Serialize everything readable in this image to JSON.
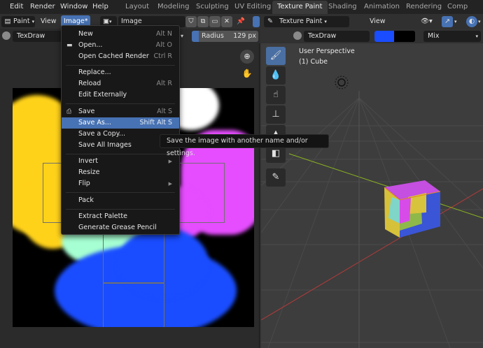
{
  "topbar": {
    "menus": [
      "Edit",
      "Render",
      "Window",
      "Help"
    ],
    "workspace_tabs": [
      "Layout",
      "Modeling",
      "Sculpting",
      "UV Editing",
      "Texture Paint",
      "Shading",
      "Animation",
      "Rendering",
      "Comp"
    ],
    "active_tab": "Texture Paint"
  },
  "image_editor": {
    "mode": "Paint",
    "view_menu": "View",
    "image_menu": "Image*",
    "image_name": "Image",
    "brush_name": "TexDraw",
    "radius_label": "Radius",
    "radius_value": "129 px"
  },
  "image_menu": {
    "items": [
      {
        "label": "New",
        "shortcut": "Alt N",
        "icon": ""
      },
      {
        "label": "Open...",
        "shortcut": "Alt O",
        "icon": "folder-icon"
      },
      {
        "label": "Open Cached Render",
        "shortcut": "Ctrl R",
        "icon": ""
      },
      {
        "label": "Replace...",
        "shortcut": "",
        "icon": ""
      },
      {
        "label": "Reload",
        "shortcut": "Alt R",
        "icon": ""
      },
      {
        "label": "Edit Externally",
        "shortcut": "",
        "icon": ""
      },
      {
        "label": "Save",
        "shortcut": "Alt S",
        "icon": "save-icon"
      },
      {
        "label": "Save As...",
        "shortcut": "Shift Alt S",
        "icon": ""
      },
      {
        "label": "Save a Copy...",
        "shortcut": "",
        "icon": ""
      },
      {
        "label": "Save All Images",
        "shortcut": "",
        "icon": ""
      },
      {
        "label": "Invert",
        "shortcut": "",
        "icon": "submenu"
      },
      {
        "label": "Resize",
        "shortcut": "",
        "icon": ""
      },
      {
        "label": "Flip",
        "shortcut": "",
        "icon": "submenu"
      },
      {
        "label": "Pack",
        "shortcut": "",
        "icon": ""
      },
      {
        "label": "Extract Palette",
        "shortcut": "",
        "icon": ""
      },
      {
        "label": "Generate Grease Pencil",
        "shortcut": "",
        "icon": ""
      }
    ],
    "highlighted": "Save As...",
    "tooltip": "Save the image with another name and/or settings."
  },
  "viewport": {
    "mode": "Texture Paint",
    "view_menu": "View",
    "brush_name": "TexDraw",
    "blend_mode": "Mix",
    "brush_color": "#1a4dff",
    "perspective": "User Perspective",
    "object": "(1) Cube"
  },
  "colors": {
    "accent": "#4772b3",
    "paint_yellow": "#ffd21a",
    "paint_magenta": "#e64dff",
    "paint_blue": "#1a4dff",
    "paint_mint": "#a6ffd2"
  }
}
